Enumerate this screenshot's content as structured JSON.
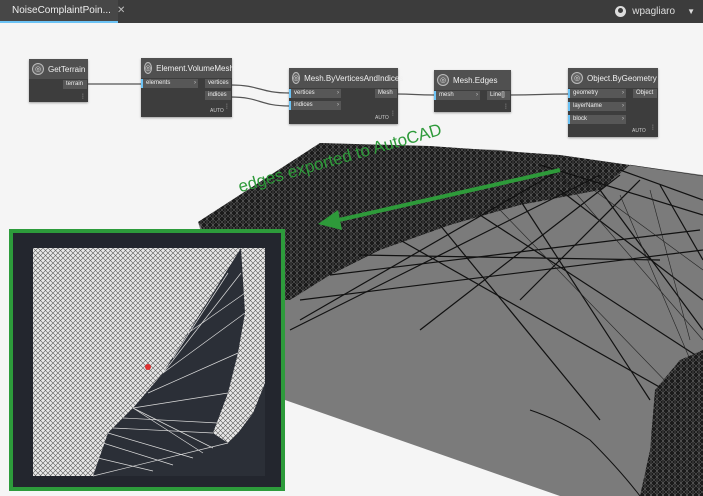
{
  "tab": {
    "title": "NoiseComplaintPoin..."
  },
  "user": {
    "name": "wpagliaro"
  },
  "nodes": {
    "get_terrain": {
      "title": "GetTerrain",
      "outputs": [
        "terrain"
      ]
    },
    "volume_mesh": {
      "title": "Element.VolumeMesh",
      "inputs": [
        "elements"
      ],
      "outputs": [
        "vertices",
        "indices"
      ],
      "lacing": "AUTO"
    },
    "mesh_by_vi": {
      "title": "Mesh.ByVerticesAndIndices",
      "inputs": [
        "vertices",
        "indices"
      ],
      "outputs": [
        "Mesh"
      ],
      "lacing": "AUTO"
    },
    "mesh_edges": {
      "title": "Mesh.Edges",
      "inputs": [
        "mesh"
      ],
      "outputs": [
        "Line[]"
      ]
    },
    "object_by_geometry": {
      "title": "Object.ByGeometry",
      "inputs": [
        "geometry",
        "layerName",
        "block"
      ],
      "outputs": [
        "Object"
      ],
      "lacing": "AUTO"
    }
  },
  "annotation": {
    "text": "edges exported to AutoCAD"
  },
  "colors": {
    "accent_green": "#2e9a3a",
    "port_blue": "#6cc3f5",
    "tab_modified": "#f0a63a",
    "terrain_gray": "#7b7b7b"
  }
}
